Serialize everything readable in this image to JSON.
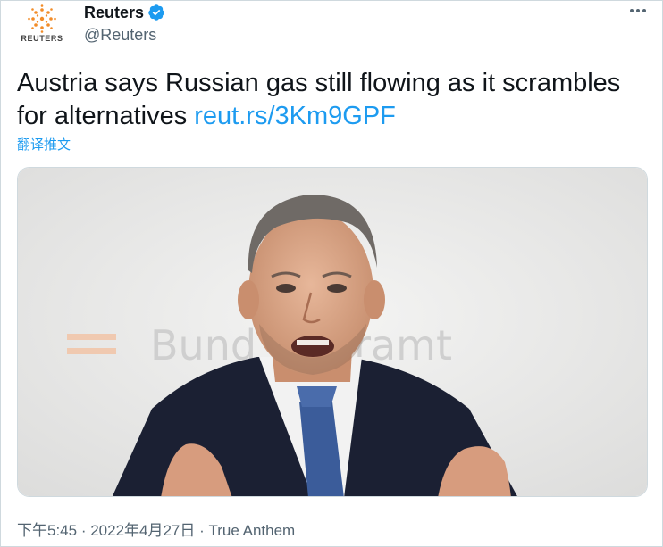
{
  "account": {
    "name": "Reuters",
    "handle": "@Reuters",
    "logo_text": "REUTERS",
    "verified": true
  },
  "tweet": {
    "text": "Austria says Russian gas still flowing as it scrambles for alternatives ",
    "link": "reut.rs/3Km9GPF",
    "translate_label": "翻译推文",
    "image_backdrop_text": "Bund      nzleramt"
  },
  "meta": {
    "time": "下午5:45",
    "separator1": " · ",
    "date": "2022年4月27日",
    "separator2": " · ",
    "source": "True Anthem"
  },
  "colors": {
    "link": "#1d9bf0",
    "secondary": "#536471",
    "verified": "#1d9bf0",
    "logo": "#f28c28"
  },
  "icons": {
    "more": "more-horizontal-icon",
    "verified": "verified-badge-icon",
    "logo": "reuters-logo"
  }
}
